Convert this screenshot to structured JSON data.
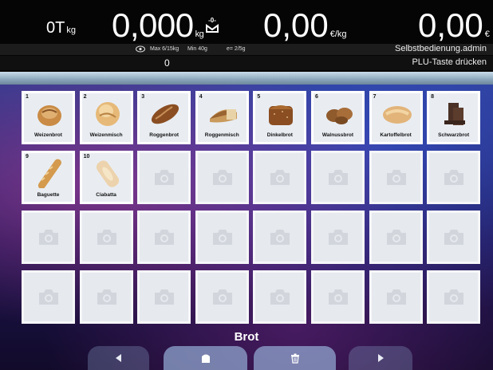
{
  "header": {
    "tare": "0T",
    "tare_unit": "kg",
    "weight": "0,000",
    "weight_unit": "kg",
    "unit_price": "0,00",
    "unit_price_unit": "€/kg",
    "total": "0,00",
    "total_unit": "€",
    "zero_icon": "zero-scale-icon"
  },
  "info": {
    "max": "Max 6/15kg",
    "min": "Min 40g",
    "e": "e= 2/5g",
    "user": "Selbstbedienung.admin"
  },
  "status": {
    "quantity": "0",
    "message": "PLU-Taste drücken"
  },
  "products": [
    {
      "num": "1",
      "label": "Weizenbrot",
      "icon": "weizenbrot-icon"
    },
    {
      "num": "2",
      "label": "Weizenmisch",
      "icon": "weizenmisch-icon"
    },
    {
      "num": "3",
      "label": "Roggenbrot",
      "icon": "roggenbrot-icon"
    },
    {
      "num": "4",
      "label": "Roggenmisch",
      "icon": "roggenmisch-icon"
    },
    {
      "num": "5",
      "label": "Dinkelbrot",
      "icon": "dinkelbrot-icon"
    },
    {
      "num": "6",
      "label": "Walnussbrot",
      "icon": "walnussbrot-icon"
    },
    {
      "num": "7",
      "label": "Kartoffelbrot",
      "icon": "kartoffelbrot-icon"
    },
    {
      "num": "8",
      "label": "Schwarzbrot",
      "icon": "schwarzbrot-icon"
    },
    {
      "num": "9",
      "label": "Baguette",
      "icon": "baguette-icon"
    },
    {
      "num": "10",
      "label": "Ciabatta",
      "icon": "ciabatta-icon"
    }
  ],
  "category": "Brot",
  "colors": {
    "bread_light": "#d9a865",
    "bread_dark": "#8a4e22",
    "placeholder": "#d2d6dc"
  }
}
